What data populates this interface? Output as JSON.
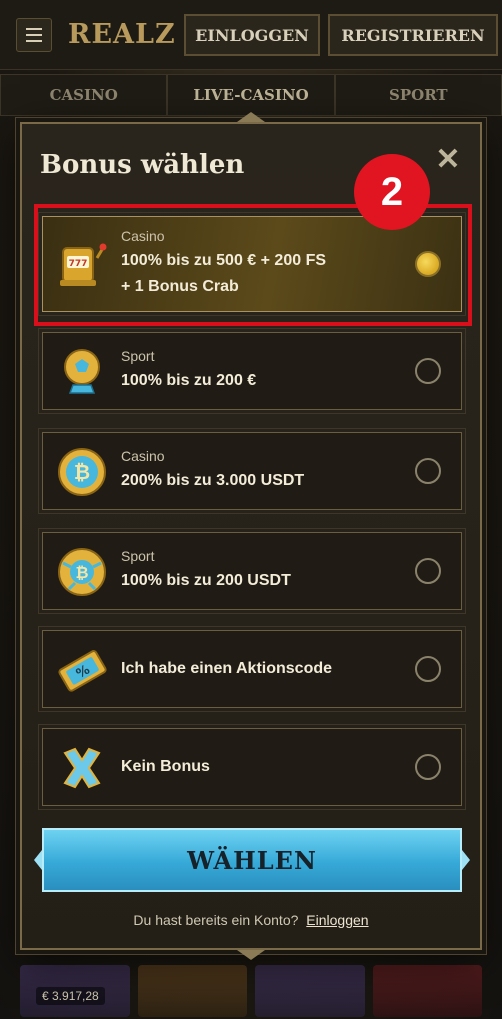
{
  "header": {
    "logo": "REALZ",
    "login_label": "EINLOGGEN",
    "register_label": "REGISTRIEREN"
  },
  "nav_tabs": [
    "CASINO",
    "LIVE-CASINO",
    "SPORT"
  ],
  "background": {
    "game_amount": "€ 3.917,28"
  },
  "modal": {
    "title": "Bonus wählen",
    "close_symbol": "✕",
    "step_badge": "2",
    "options": [
      {
        "kicker": "Casino",
        "main_line1": "100% bis zu 500 € + 200 FS",
        "main_line2": "+ 1 Bonus Crab",
        "icon": "slot-machine-icon",
        "selected": true
      },
      {
        "kicker": "Sport",
        "main_line1": "100% bis zu 200 €",
        "icon": "soccer-ball-trophy-icon",
        "selected": false
      },
      {
        "kicker": "Casino",
        "main_line1": "200% bis zu 3.000 USDT",
        "icon": "bitcoin-coin-icon",
        "selected": false
      },
      {
        "kicker": "Sport",
        "main_line1": "100% bis zu 200 USDT",
        "icon": "bitcoin-ball-icon",
        "selected": false
      },
      {
        "kicker": "",
        "main_line1": "Ich habe einen Aktionscode",
        "icon": "percent-ticket-icon",
        "selected": false
      },
      {
        "kicker": "",
        "main_line1": "Kein Bonus",
        "icon": "cross-icon",
        "selected": false
      }
    ],
    "choose_label": "WÄHLEN",
    "footer_text": "Du hast bereits ein Konto?",
    "footer_link": "Einloggen"
  },
  "colors": {
    "accent_gold": "#d9a922",
    "cta_blue": "#36a9d8",
    "highlight_red": "#d90f1c"
  }
}
